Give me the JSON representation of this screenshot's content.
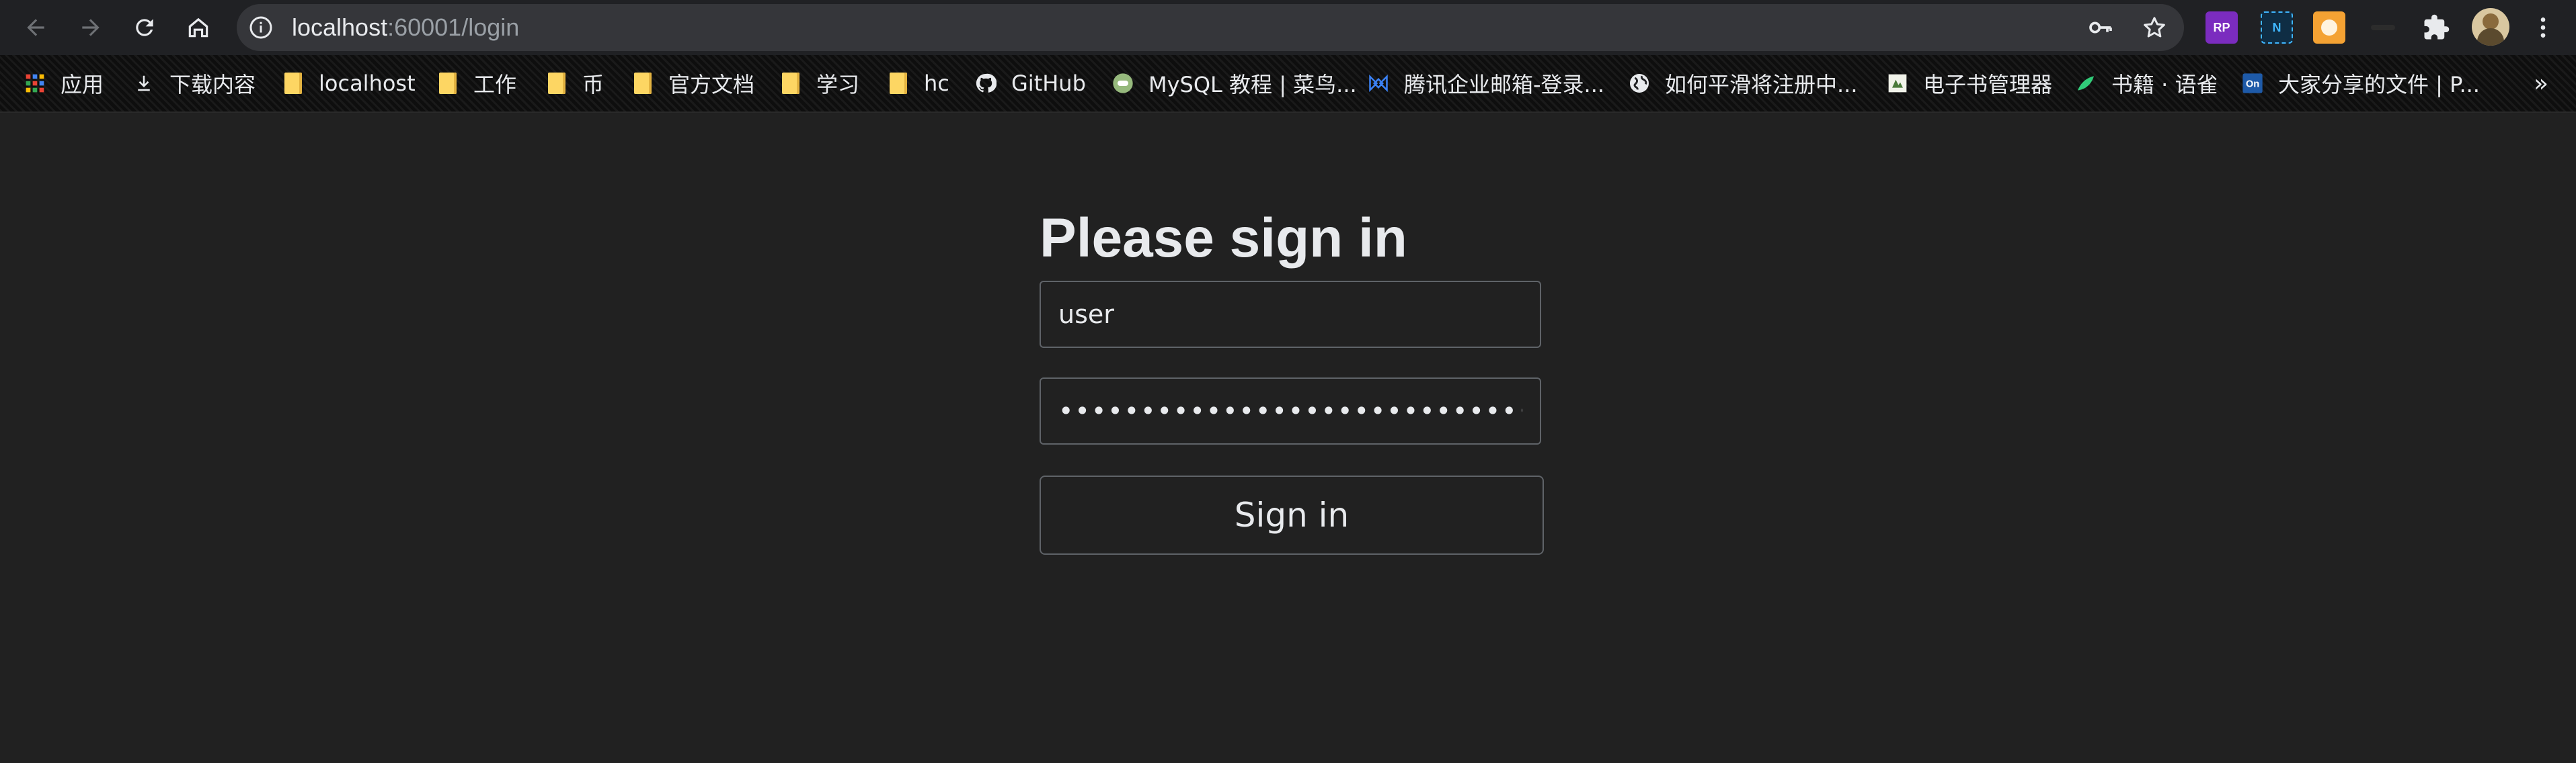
{
  "browser": {
    "url_host": "localhost",
    "url_rest": ":60001/login",
    "extensions": [
      {
        "name": "rp-extension-icon",
        "label": "RP",
        "color": "#7b2cbf"
      },
      {
        "name": "n-extension-icon",
        "label": "N",
        "color": "#1b6fa8"
      },
      {
        "name": "orange-extension-icon",
        "label": "",
        "color": "#f4a233"
      }
    ]
  },
  "bookmarks": [
    {
      "label": "应用",
      "icon": "apps-grid-icon"
    },
    {
      "label": "下载内容",
      "icon": "download-icon"
    },
    {
      "label": "localhost",
      "icon": "folder-icon"
    },
    {
      "label": "工作",
      "icon": "folder-icon"
    },
    {
      "label": "币",
      "icon": "folder-icon"
    },
    {
      "label": "官方文档",
      "icon": "folder-icon"
    },
    {
      "label": "学习",
      "icon": "folder-icon"
    },
    {
      "label": "hc",
      "icon": "folder-icon"
    },
    {
      "label": "GitHub",
      "icon": "github-icon"
    },
    {
      "label": "MySQL 教程 | 菜鸟...",
      "icon": "runoob-icon"
    },
    {
      "label": "腾讯企业邮箱-登录...",
      "icon": "tencent-mail-icon"
    },
    {
      "label": "如何平滑将注册中...",
      "icon": "globe-icon"
    },
    {
      "label": "电子书管理器",
      "icon": "ebook-icon"
    },
    {
      "label": "书籍 · 语雀",
      "icon": "yuque-icon"
    },
    {
      "label": "大家分享的文件 | P...",
      "icon": "onedrive-icon"
    }
  ],
  "bookmarks_overflow": "»",
  "login": {
    "title": "Please sign in",
    "username_value": "user",
    "password_value": "••••••••••••••••••••••••••••••••••••",
    "submit_label": "Sign in"
  },
  "colors": {
    "page_background": "#212121",
    "toolbar_background": "#202124",
    "omnibox_background": "#35363a",
    "input_border": "#5f6368",
    "text": "#e8eaed"
  }
}
